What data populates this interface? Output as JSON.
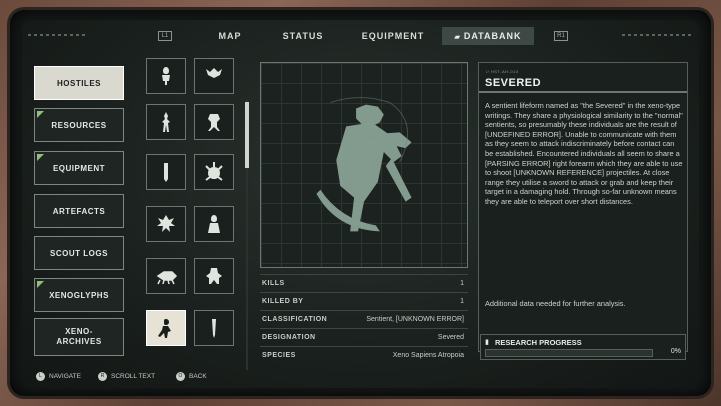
{
  "tabs": {
    "left_key": "L1",
    "right_key": "R1",
    "items": [
      "MAP",
      "STATUS",
      "EQUIPMENT",
      "DATABANK"
    ],
    "active": "DATABANK"
  },
  "menu": {
    "items": [
      "HOSTILES",
      "RESOURCES",
      "EQUIPMENT",
      "ARTEFACTS",
      "SCOUT LOGS",
      "XENOGLYPHS",
      "XENO-",
      "ARCHIVES"
    ],
    "active": "HOSTILES"
  },
  "entry": {
    "code": "// HST-AH-013",
    "title": "SEVERED",
    "description": "A sentient lifeform named as \"the Severed\" in the xeno-type writings. They share a physiological similarity to the \"normal\" sentients, so presumably these individuals are the result of [UNDEFINED ERROR]. Unable to communicate with them as they seem to attack indiscriminately before contact can be established. Encountered individuals all seem to share a [PARSING ERROR] right forearm which they are able to use to shoot [UNKNOWN REFERENCE] projectiles. At close range they utilise a sword to attack or grab and keep their target in a damaging hold. Through so-far unknown means they are able to teleport over short distances.",
    "additional": "Additional data needed for further analysis."
  },
  "stats": {
    "kills_label": "KILLS",
    "kills_value": "1",
    "killed_by_label": "KILLED BY",
    "killed_by_value": "1",
    "classification_label": "CLASSIFICATION",
    "classification_value": "Sentient, [UNKNOWN ERROR]",
    "designation_label": "DESIGNATION",
    "designation_value": "Severed",
    "species_label": "SPECIES",
    "species_value": "Xeno Sapiens Atropoia"
  },
  "research": {
    "label": "RESEARCH PROGRESS",
    "percent_text": "0%",
    "progress": 0
  },
  "controls": {
    "navigate": "NAVIGATE",
    "scroll": "SCROLL TEXT",
    "back": "BACK",
    "navigate_key": "L",
    "scroll_key": "R",
    "back_key": "O"
  },
  "colors": {
    "accent_green": "#8fbf7a",
    "screen_bg": "#1a201d",
    "active_item": "#d9d9cf"
  }
}
